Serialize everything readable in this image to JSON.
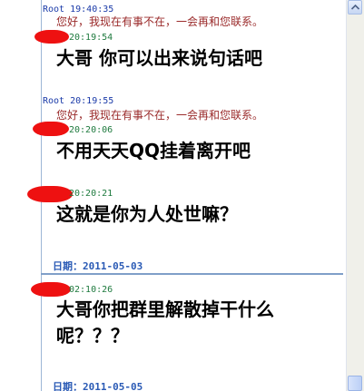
{
  "messages": [
    {
      "sender": "Root",
      "time": "19:40:35",
      "auto_reply": "您好，我现在有事不在，一会再和您联系。"
    },
    {
      "time": "20:19:54",
      "text": "大哥  你可以出来说句话吧"
    },
    {
      "sender": "Root",
      "time": "20:19:55",
      "auto_reply": "您好，我现在有事不在，一会再和您联系。"
    },
    {
      "time": "20:20:06",
      "text": "不用天天QQ挂着离开吧"
    },
    {
      "time": "20:20:21",
      "text": "这就是你为人处世嘛？"
    },
    {
      "time": "02:10:26",
      "text": "大哥你把群里解散掉干什么呢？？？"
    }
  ],
  "dates": [
    {
      "label": "日期：",
      "value": "2011-05-03"
    },
    {
      "label": "日期：",
      "value": "2011-05-05"
    }
  ],
  "colors": {
    "sender": "#1a3aa8",
    "peer_time": "#1e7a3e",
    "auto_reply": "#9a2a2a",
    "date": "#2a5ab5",
    "redaction": "#ee1111"
  }
}
